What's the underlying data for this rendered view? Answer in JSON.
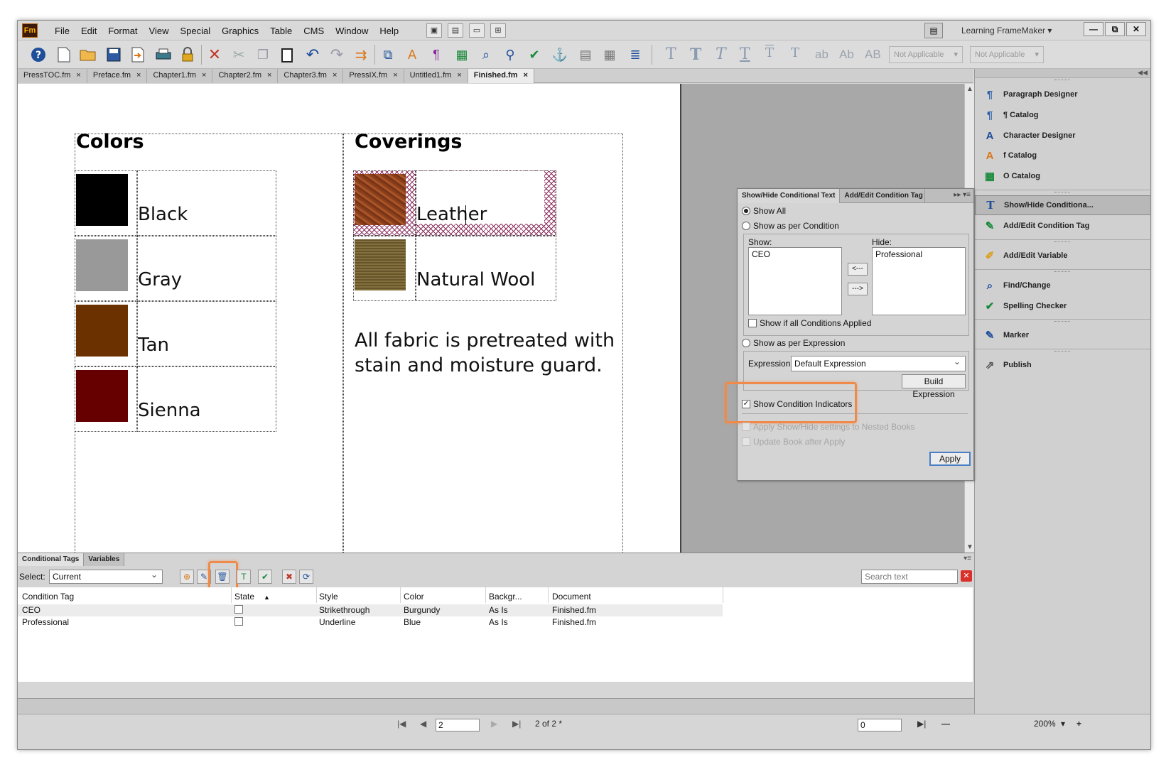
{
  "app": {
    "logo": "Fm",
    "menus": [
      "File",
      "Edit",
      "Format",
      "View",
      "Special",
      "Graphics",
      "Table",
      "CMS",
      "Window",
      "Help"
    ],
    "workspace": "Learning FrameMaker",
    "workspace_arrow": "▾",
    "win_min": "—",
    "win_max": "⧉",
    "win_close": "✕"
  },
  "toolbar": {
    "not_applicable_1": "Not Applicable",
    "not_applicable_2": "Not Applicable",
    "text_styles": [
      "T",
      "T",
      "T",
      "T",
      "T",
      "T"
    ],
    "case_styles": [
      "ab",
      "Ab",
      "AB"
    ]
  },
  "doc_tabs": [
    {
      "label": "PressTOC.fm",
      "close": "×"
    },
    {
      "label": "Preface.fm",
      "close": "×"
    },
    {
      "label": "Chapter1.fm",
      "close": "×"
    },
    {
      "label": "Chapter2.fm",
      "close": "×"
    },
    {
      "label": "Chapter3.fm",
      "close": "×"
    },
    {
      "label": "PressIX.fm",
      "close": "×"
    },
    {
      "label": "Untitled1.fm",
      "close": "×"
    },
    {
      "label": "Finished.fm",
      "close": "×"
    }
  ],
  "document": {
    "colors_heading": "Colors",
    "colors": [
      {
        "name": "Black",
        "swatch": "#000000"
      },
      {
        "name": "Gray",
        "swatch": "#999999"
      },
      {
        "name": "Tan",
        "swatch": "#6b3200"
      },
      {
        "name": "Sienna",
        "swatch": "#660000"
      }
    ],
    "coverings_heading": "Coverings",
    "coverings": [
      {
        "name": "Leather"
      },
      {
        "name": "Natural Wool"
      }
    ],
    "note_line1": "All fabric is pretreated with",
    "note_line2": "stain and moisture guard."
  },
  "dialog": {
    "tab_active": "Show/Hide Conditional Text",
    "tab_other": "Add/Edit Condition Tag",
    "more": "▸▸ ▾≡",
    "show_all": "Show All",
    "show_as_per_condition": "Show as per Condition",
    "show_label": "Show:",
    "hide_label": "Hide:",
    "show_list": [
      "CEO"
    ],
    "hide_list": [
      "Professional"
    ],
    "move_left": "<---",
    "move_right": "--->",
    "show_if_all": "Show if all Conditions Applied",
    "show_as_per_expression": "Show as per Expression",
    "expression_label": "Expression:",
    "expression_value": "Default Expression",
    "build_expression": "Build Expression",
    "show_condition_indicators": "Show Condition Indicators",
    "check_mark": "✓",
    "apply_nested": "Apply Show/Hide settings to Nested Books",
    "update_book": "Update Book after Apply",
    "apply": "Apply"
  },
  "right_panel": {
    "items": [
      {
        "label": "Paragraph Designer",
        "icon": "paragraph-designer-icon",
        "glyph": "¶"
      },
      {
        "label": "¶ Catalog",
        "icon": "paragraph-catalog-icon",
        "glyph": "¶"
      },
      {
        "label": "Character Designer",
        "icon": "character-designer-icon",
        "glyph": "A"
      },
      {
        "label": "f Catalog",
        "icon": "character-catalog-icon",
        "glyph": "A"
      },
      {
        "label": "O Catalog",
        "icon": "object-catalog-icon",
        "glyph": "▦"
      },
      {
        "label": "Show/Hide Conditiona...",
        "icon": "show-hide-conditional-icon",
        "glyph": "T"
      },
      {
        "label": "Add/Edit Condition Tag",
        "icon": "condition-tag-icon",
        "glyph": "✎"
      },
      {
        "label": "Add/Edit Variable",
        "icon": "variable-icon",
        "glyph": "✐"
      },
      {
        "label": "Find/Change",
        "icon": "find-change-icon",
        "glyph": "⌕"
      },
      {
        "label": "Spelling Checker",
        "icon": "spelling-checker-icon",
        "glyph": "✔"
      },
      {
        "label": "Marker",
        "icon": "marker-icon",
        "glyph": "✎"
      },
      {
        "label": "Publish",
        "icon": "publish-icon",
        "glyph": "⇗"
      }
    ]
  },
  "bottom_panel": {
    "tab_active": "Conditional Tags",
    "tab_other": "Variables",
    "select_label": "Select:",
    "select_value": "Current",
    "search_placeholder": "Search text",
    "clear": "✕",
    "columns": [
      "Condition Tag",
      "State",
      "Style",
      "Color",
      "Backgr...",
      "Document"
    ],
    "sort_arrow": "▲",
    "rows": [
      {
        "tag": "CEO",
        "style": "Strikethrough",
        "color": "Burgundy",
        "background": "As Is",
        "document": "Finished.fm"
      },
      {
        "tag": "Professional",
        "style": "Underline",
        "color": "Blue",
        "background": "As Is",
        "document": "Finished.fm"
      }
    ]
  },
  "status": {
    "page_input": "2",
    "page_count": "2 of 2 *",
    "zoom_input": "0",
    "zoom": "200%",
    "first": "|◀",
    "prev": "◀",
    "next": "▶",
    "last": "▶|",
    "zoom_out": "—",
    "zoom_in": "+"
  },
  "colors": {
    "highlight": "#f08a4b",
    "condition_hatch": "#8a2a5a"
  }
}
